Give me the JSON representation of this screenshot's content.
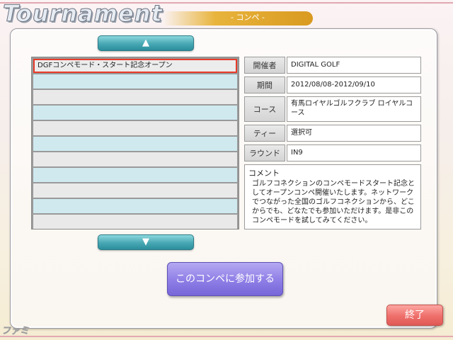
{
  "header": {
    "title": "Tournament",
    "subtitle": "- コンペ -"
  },
  "list": {
    "scroll_up_label": "▲",
    "scroll_down_label": "▼",
    "rows": [
      "DGFコンペモード・スタート記念オープン",
      "",
      "",
      "",
      "",
      "",
      "",
      "",
      "",
      "",
      "",
      ""
    ],
    "selected_index": 0
  },
  "details": {
    "organizer_label": "開催者",
    "organizer_value": "DIGITAL GOLF",
    "period_label": "期間",
    "period_value": "2012/08/08-2012/09/10",
    "course_label": "コース",
    "course_value": "有馬ロイヤルゴルフクラブ ロイヤルコース",
    "tee_label": "ティー",
    "tee_value": "選択可",
    "round_label": "ラウンド",
    "round_value": "IN9",
    "comment_label": "コメント",
    "comment_text": "ゴルフコネクションのコンペモードスタート記念としてオープンコンペ開催いたします。ネットワークでつながった全国のゴルフコネクションから、どこからでも、どなたでも参加いただけます。是非このコンペモードを試してみてください。"
  },
  "actions": {
    "join_label": "このコンペに参加する",
    "exit_label": "終了"
  },
  "watermark": "ファミ通.com",
  "colors": {
    "selected_outline": "#e83a2a",
    "row_alt": "#cfe9ef",
    "join_button": "#8e7ee6",
    "exit_button": "#ef6f6b",
    "scroll_button": "#47a7b3"
  }
}
